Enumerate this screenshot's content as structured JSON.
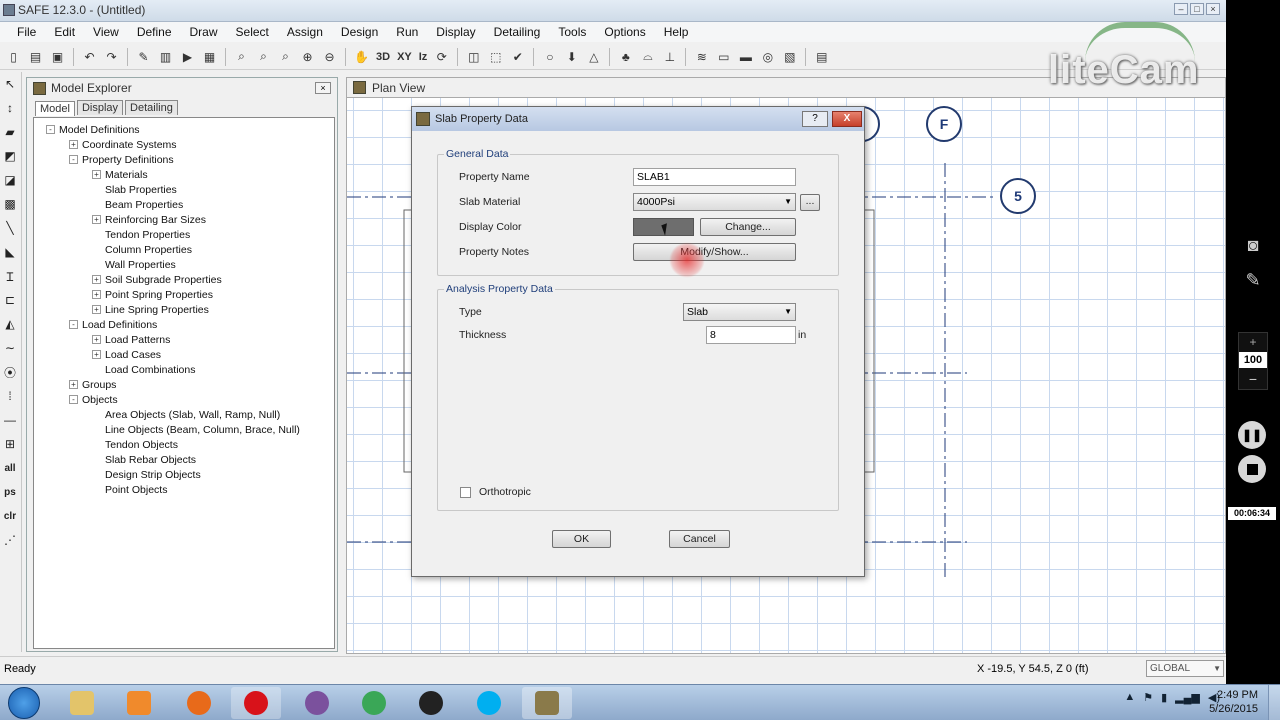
{
  "window": {
    "title": "SAFE 12.3.0 - (Untitled)"
  },
  "menu": [
    "File",
    "Edit",
    "View",
    "Define",
    "Draw",
    "Select",
    "Assign",
    "Design",
    "Run",
    "Display",
    "Detailing",
    "Tools",
    "Options",
    "Help"
  ],
  "toolbar": {
    "btn_3d": "3D",
    "btn_xy": "XY",
    "btn_z": "Iz"
  },
  "left_tools": {
    "all": "all",
    "ps": "ps",
    "clr": "clr"
  },
  "explorer": {
    "title": "Model Explorer",
    "tabs": [
      "Model",
      "Display",
      "Detailing"
    ],
    "tree": [
      {
        "label": "Model Definitions",
        "expander": "-"
      },
      {
        "label": "Coordinate Systems",
        "expander": "+"
      },
      {
        "label": "Property Definitions",
        "expander": "-"
      },
      {
        "label": "Materials",
        "expander": "+"
      },
      {
        "label": "Slab Properties",
        "expander": ""
      },
      {
        "label": "Beam Properties",
        "expander": ""
      },
      {
        "label": "Reinforcing Bar Sizes",
        "expander": "+"
      },
      {
        "label": "Tendon Properties",
        "expander": ""
      },
      {
        "label": "Column Properties",
        "expander": ""
      },
      {
        "label": "Wall Properties",
        "expander": ""
      },
      {
        "label": "Soil Subgrade Properties",
        "expander": "+"
      },
      {
        "label": "Point Spring Properties",
        "expander": "+"
      },
      {
        "label": "Line Spring Properties",
        "expander": "+"
      },
      {
        "label": "Load Definitions",
        "expander": "-"
      },
      {
        "label": "Load Patterns",
        "expander": "+"
      },
      {
        "label": "Load Cases",
        "expander": "+"
      },
      {
        "label": "Load Combinations",
        "expander": ""
      },
      {
        "label": "Groups",
        "expander": "+"
      },
      {
        "label": "Objects",
        "expander": "-"
      },
      {
        "label": "Area Objects (Slab, Wall, Ramp, Null)",
        "expander": ""
      },
      {
        "label": "Line Objects (Beam, Column, Brace, Null)",
        "expander": ""
      },
      {
        "label": "Tendon Objects",
        "expander": ""
      },
      {
        "label": "Slab Rebar Objects",
        "expander": ""
      },
      {
        "label": "Design Strip Objects",
        "expander": ""
      },
      {
        "label": "Point Objects",
        "expander": ""
      }
    ]
  },
  "plan": {
    "title": "Plan View",
    "bubble_f": "F",
    "bubble_5": "5"
  },
  "dialog": {
    "title": "Slab Property Data",
    "help": "?",
    "close": "X",
    "general_label": "General Data",
    "property_name_label": "Property Name",
    "property_name_value": "SLAB1",
    "slab_material_label": "Slab Material",
    "slab_material_value": "4000Psi",
    "display_color_label": "Display Color",
    "display_color": "#6e6e6e",
    "change_button": "Change...",
    "property_notes_label": "Property Notes",
    "modify_button": "Modify/Show...",
    "analysis_label": "Analysis Property Data",
    "type_label": "Type",
    "type_value": "Slab",
    "thickness_label": "Thickness",
    "thickness_value": "8",
    "thickness_unit": "in",
    "orthotropic_label": "Orthotropic",
    "ok_button": "OK",
    "cancel_button": "Cancel"
  },
  "status": {
    "ready": "Ready",
    "coords": "X -19.5,  Y 54.5,  Z 0  (ft)",
    "coord_system": "GLOBAL"
  },
  "recorder": {
    "watermark": "liteCam",
    "zoom": "100",
    "zoom_in": "+",
    "zoom_out": "−",
    "timer": "00:06:34"
  },
  "taskbar": {
    "time": "2:49 PM",
    "date": "5/26/2015"
  }
}
